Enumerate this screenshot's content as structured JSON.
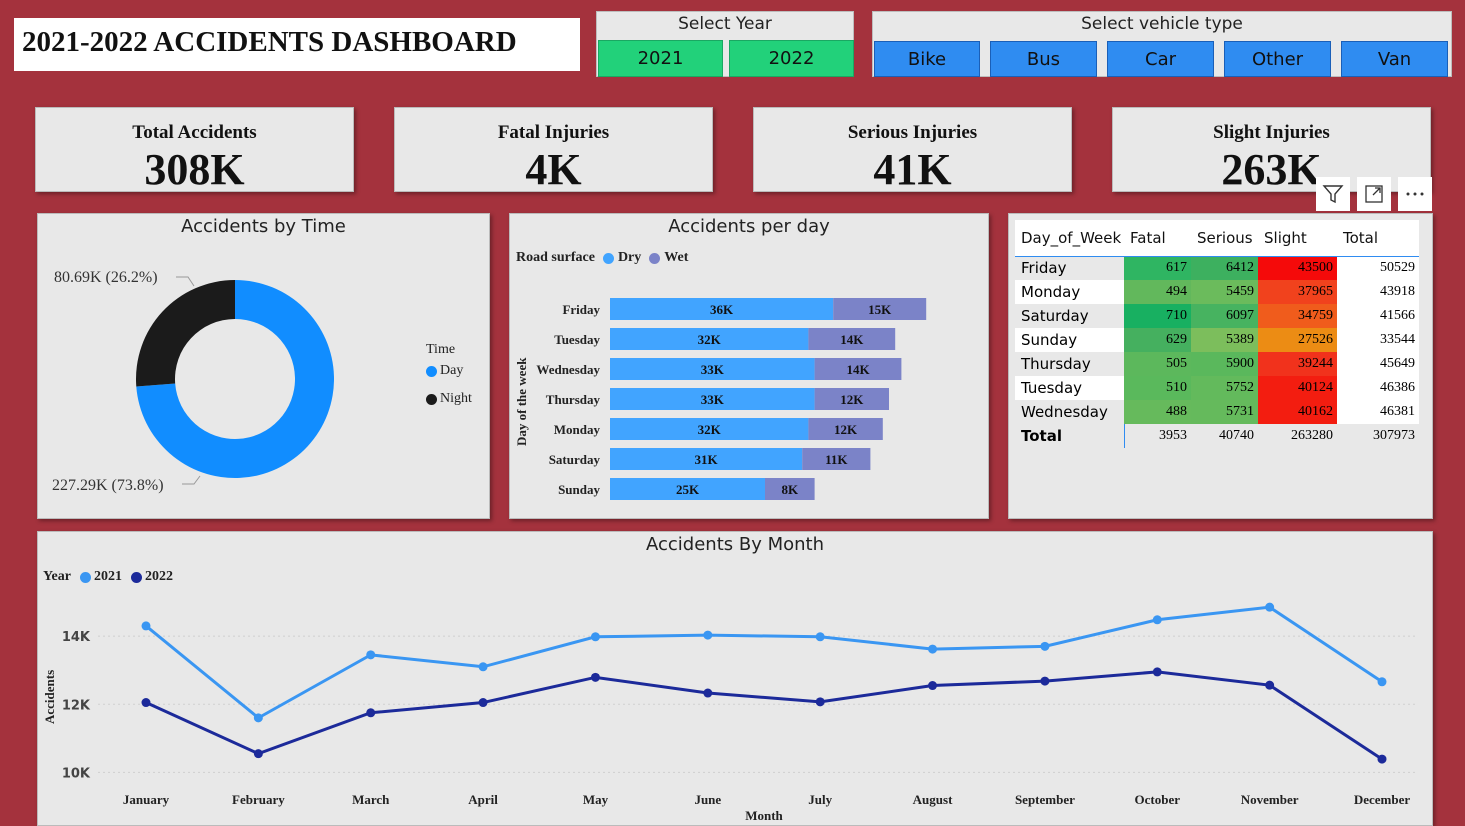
{
  "header": {
    "title": "2021-2022 ACCIDENTS DASHBOARD"
  },
  "year_slicer": {
    "label": "Select Year",
    "options": [
      "2021",
      "2022"
    ]
  },
  "vehicle_slicer": {
    "label": "Select vehicle type",
    "options": [
      "Bike",
      "Bus",
      "Car",
      "Other",
      "Van"
    ]
  },
  "kpis": [
    {
      "label": "Total Accidents",
      "value": "308K"
    },
    {
      "label": "Fatal Injuries",
      "value": "4K"
    },
    {
      "label": "Serious Injuries",
      "value": "41K"
    },
    {
      "label": "Slight Injuries",
      "value": "263K"
    }
  ],
  "colors": {
    "background": "#a4323d",
    "day": "#118dff",
    "night": "#1b1b1b",
    "dry": "#41a4ff",
    "wet": "#7b83c8",
    "y2021": "#3a96f2",
    "y2022": "#1c2a9a",
    "slicer_green": "#22d17a",
    "slicer_blue": "#2f8cf1"
  },
  "visual_header_icons": [
    "filter-icon",
    "focus-mode-icon",
    "more-options-icon"
  ],
  "chart_data": [
    {
      "type": "pie",
      "title": "Accidents by Time",
      "legend_title": "Time",
      "legend_position": "right",
      "categories": [
        "Day",
        "Night"
      ],
      "values": [
        227.29,
        80.69
      ],
      "labels": [
        "227.29K (73.8%)",
        "80.69K (26.2%)"
      ]
    },
    {
      "type": "bar",
      "title": "Accidents per day",
      "legend_title": "Road surface",
      "legend_position": "top-left",
      "ylabel": "Day of the week",
      "categories": [
        "Friday",
        "Tuesday",
        "Wednesday",
        "Thursday",
        "Monday",
        "Saturday",
        "Sunday"
      ],
      "series": [
        {
          "name": "Dry",
          "values": [
            36,
            32,
            33,
            33,
            32,
            31,
            25
          ],
          "labels": [
            "36K",
            "32K",
            "33K",
            "33K",
            "32K",
            "31K",
            "25K"
          ]
        },
        {
          "name": "Wet",
          "values": [
            15,
            14,
            14,
            12,
            12,
            11,
            8
          ],
          "labels": [
            "15K",
            "14K",
            "14K",
            "12K",
            "12K",
            "11K",
            "8K"
          ]
        }
      ]
    },
    {
      "type": "table",
      "columns": [
        "Day_of_Week",
        "Fatal",
        "Serious",
        "Slight",
        "Total"
      ],
      "rows": [
        [
          "Friday",
          "617",
          "6412",
          "43500",
          "50529"
        ],
        [
          "Monday",
          "494",
          "5459",
          "37965",
          "43918"
        ],
        [
          "Saturday",
          "710",
          "6097",
          "34759",
          "41566"
        ],
        [
          "Sunday",
          "629",
          "5389",
          "27526",
          "33544"
        ],
        [
          "Thursday",
          "505",
          "5900",
          "39244",
          "45649"
        ],
        [
          "Tuesday",
          "510",
          "5752",
          "40124",
          "46386"
        ],
        [
          "Wednesday",
          "488",
          "5731",
          "40162",
          "46381"
        ]
      ],
      "total": [
        "Total",
        "3953",
        "40740",
        "263280",
        "307973"
      ]
    },
    {
      "type": "line",
      "title": "Accidents By Month",
      "legend_title": "Year",
      "legend_position": "top-left",
      "xlabel": "Month",
      "ylabel": "Accidents",
      "ylim": [
        10000,
        15000
      ],
      "yticks": [
        10000,
        12000,
        14000
      ],
      "ytick_labels": [
        "10K",
        "12K",
        "14K"
      ],
      "categories": [
        "January",
        "February",
        "March",
        "April",
        "May",
        "June",
        "July",
        "August",
        "September",
        "October",
        "November",
        "December"
      ],
      "series": [
        {
          "name": "2021",
          "values": [
            14300,
            11600,
            13450,
            13100,
            13980,
            14030,
            13980,
            13620,
            13700,
            14480,
            14850,
            12660
          ]
        },
        {
          "name": "2022",
          "values": [
            12050,
            10550,
            11750,
            12050,
            12790,
            12330,
            12070,
            12550,
            12680,
            12950,
            12560,
            10390
          ]
        }
      ]
    }
  ]
}
